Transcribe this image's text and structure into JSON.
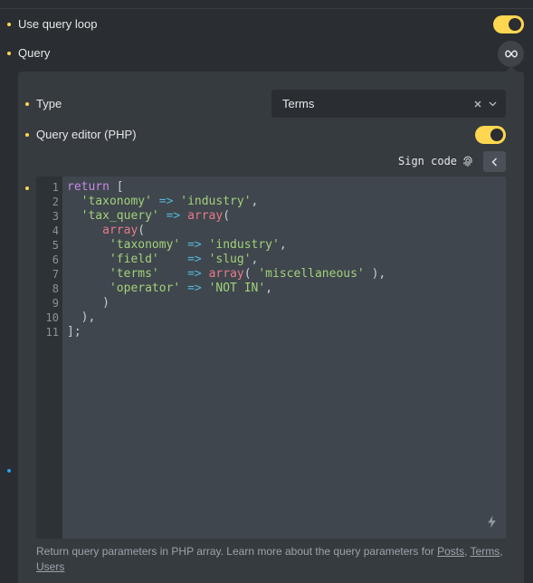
{
  "settings": {
    "use_query_loop": {
      "label": "Use query loop",
      "enabled": true
    },
    "query": {
      "label": "Query",
      "button_icon": "infinity-icon"
    }
  },
  "query_popup": {
    "type": {
      "label": "Type",
      "value": "Terms"
    },
    "php_editor": {
      "label": "Query editor (PHP)",
      "enabled": true
    },
    "sign_code_label": "Sign code",
    "code_lines": [
      "return [",
      "  'taxonomy' => 'industry',",
      "  'tax_query' => array(",
      "     array(",
      "      'taxonomy' => 'industry',",
      "      'field'    => 'slug',",
      "      'terms'    => array( 'miscellaneous' ),",
      "      'operator' => 'NOT IN',",
      "     )",
      "  ),",
      "];"
    ],
    "help": {
      "text": "Return query parameters in PHP array. Learn more about the query parameters for ",
      "links": [
        "Posts",
        "Terms",
        "Users"
      ]
    }
  },
  "colors": {
    "accent": "#ffd64f",
    "indicator_blue": "#2b9cf2",
    "background": "#2a2d31",
    "popup": "#363b40",
    "editor": "#3f464d"
  }
}
